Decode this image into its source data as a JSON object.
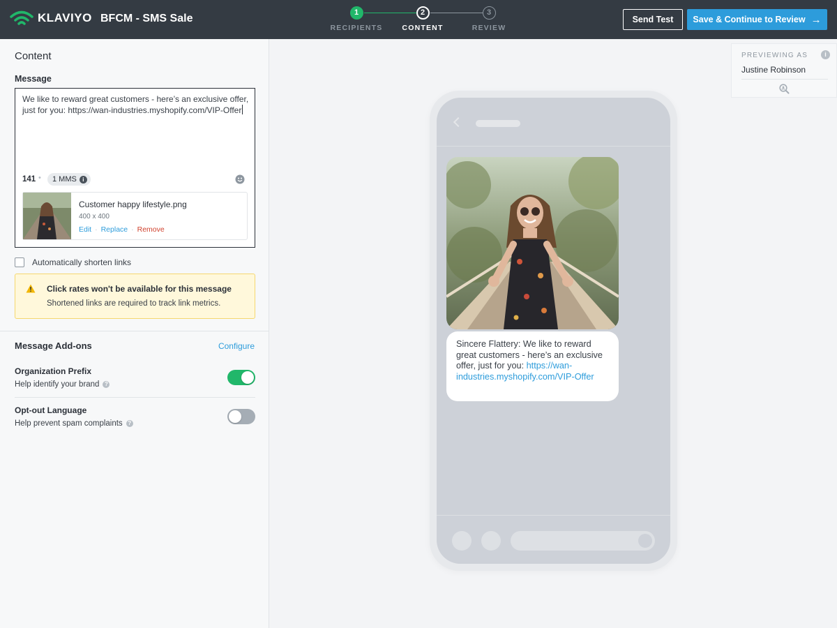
{
  "header": {
    "brand_name": "KLAVIYO",
    "campaign_title": "BFCM - SMS Sale",
    "steps": [
      {
        "number": "1",
        "label": "RECIPIENTS",
        "state": "complete"
      },
      {
        "number": "2",
        "label": "CONTENT",
        "state": "active"
      },
      {
        "number": "3",
        "label": "REVIEW",
        "state": "upcoming"
      }
    ],
    "send_test_label": "Send Test",
    "save_label": "Save & Continue to Review"
  },
  "content": {
    "title": "Content",
    "message_label": "Message",
    "message_text": "We like to reward great customers - here’s an exclusive offer, just for you: https://wan-industries.myshopify.com/VIP-Offer",
    "char_count": "141",
    "mms_badge": "1 MMS",
    "attachment": {
      "name": "Customer happy lifestyle.png",
      "dimensions": "400 x 400",
      "edit_label": "Edit",
      "replace_label": "Replace",
      "remove_label": "Remove"
    },
    "shorten_links_label": "Automatically shorten links",
    "shorten_links_checked": false,
    "warning": {
      "title": "Click rates won't be available for this message",
      "body": "Shortened links are required to track link metrics."
    }
  },
  "addons": {
    "title": "Message Add-ons",
    "configure_label": "Configure",
    "items": [
      {
        "name": "Organization Prefix",
        "description": "Help identify your brand",
        "enabled": true
      },
      {
        "name": "Opt-out Language",
        "description": "Help prevent spam complaints",
        "enabled": false
      }
    ]
  },
  "preview": {
    "previewing_as_label": "PREVIEWING AS",
    "previewing_name": "Justine Robinson",
    "bubble_prefix": "Sincere Flattery: ",
    "bubble_text": "We like to reward great customers - here’s an exclusive offer, just for you: ",
    "bubble_url": "https://wan-industries.myshopify.com/VIP-Offer"
  },
  "colors": {
    "header_bg": "#343b43",
    "accent_blue": "#2d9cdb",
    "success_green": "#21b76a",
    "warning_bg": "#fff8db",
    "danger_red": "#d0422e"
  },
  "icons": {
    "logo": "klaviyo-wifi-logo-icon",
    "save_arrow": "arrow-right-icon",
    "info": "info-icon",
    "emoji": "smiley-icon",
    "warning": "warning-triangle-icon",
    "help": "question-icon",
    "zoom": "zoom-icon",
    "back": "chevron-left-icon"
  }
}
